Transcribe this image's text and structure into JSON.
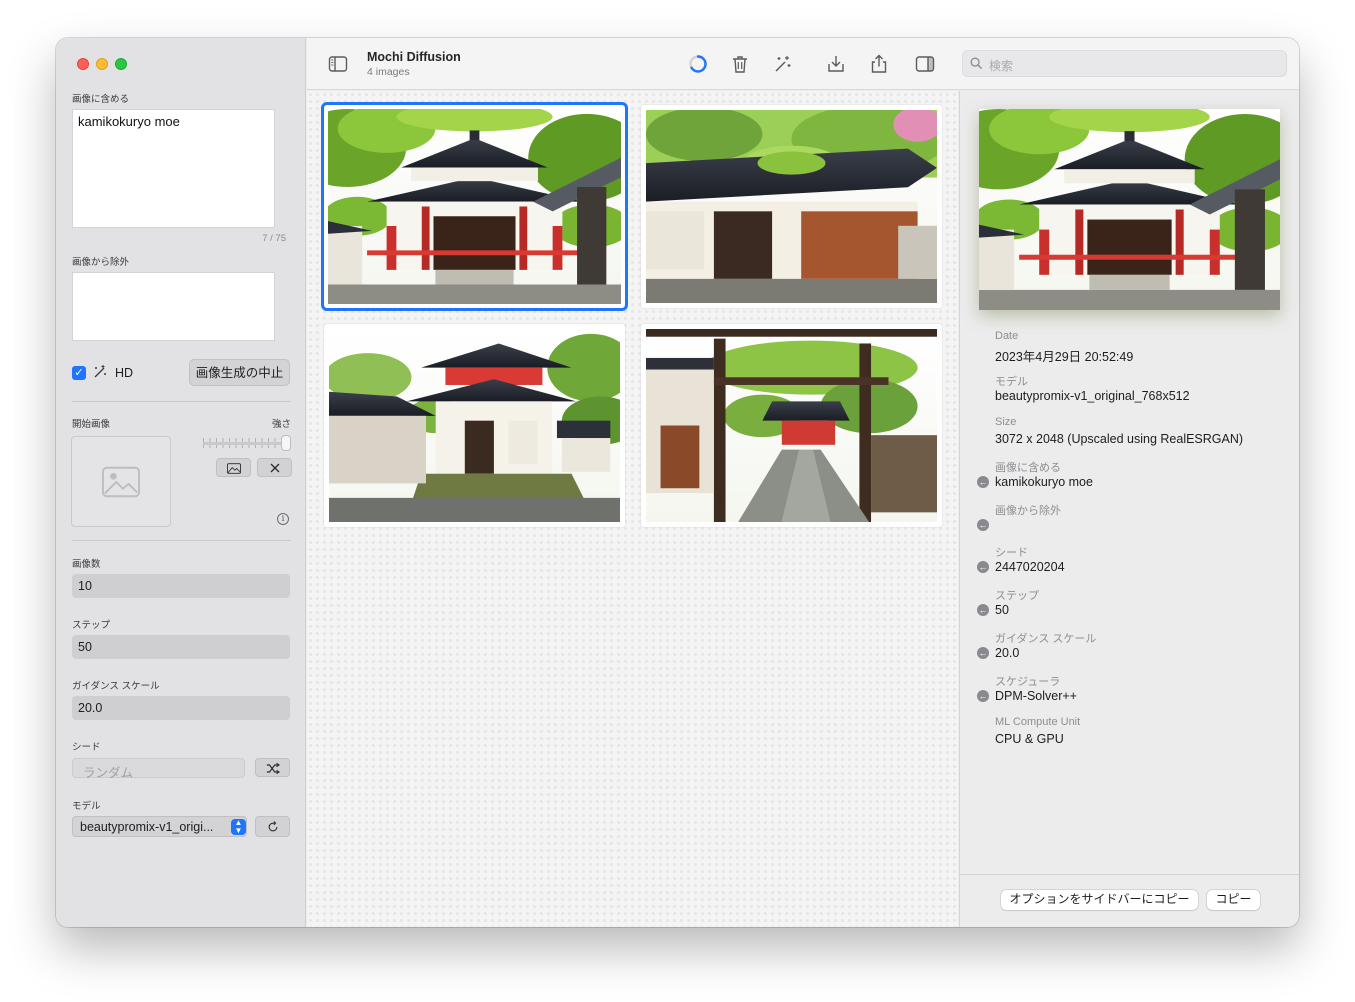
{
  "toolbar": {
    "title": "Mochi Diffusion",
    "subtitle": "4 images",
    "search_placeholder": "検索",
    "icons": [
      "sidebar-toggle-icon",
      "progress-spinner-icon",
      "trash-icon",
      "magic-wand-icon",
      "download-icon",
      "share-icon",
      "inspector-toggle-icon",
      "search-icon"
    ]
  },
  "sidebar": {
    "prompt_label": "画像に含める",
    "prompt_value": "kamikokuryo moe",
    "prompt_counter": "7 / 75",
    "negative_label": "画像から除外",
    "negative_value": "",
    "hd_checked": true,
    "hd_label": "HD",
    "stop_button": "画像生成の中止",
    "start_image_label": "開始画像",
    "strength_label": "強さ",
    "image_count_label": "画像数",
    "image_count_value": "10",
    "steps_label": "ステップ",
    "steps_value": "50",
    "guidance_label": "ガイダンス スケール",
    "guidance_value": "20.0",
    "seed_label": "シード",
    "seed_placeholder": "ランダム",
    "model_label": "モデル",
    "model_value": "beautypromix-v1_origi..."
  },
  "gallery": {
    "images": [
      {
        "alt": "temple-front",
        "selected": true
      },
      {
        "alt": "temple-side",
        "selected": false
      },
      {
        "alt": "pagoda-corner",
        "selected": false
      },
      {
        "alt": "torii-path",
        "selected": false
      }
    ]
  },
  "inspector": {
    "date_label": "Date",
    "date_value": "2023年4月29日 20:52:49",
    "model_label": "モデル",
    "model_value": "beautypromix-v1_original_768x512",
    "size_label": "Size",
    "size_value": "3072 x 2048 (Upscaled using RealESRGAN)",
    "prompt_label": "画像に含める",
    "prompt_value": "kamikokuryo moe",
    "negative_label": "画像から除外",
    "negative_value": "",
    "seed_label": "シード",
    "seed_value": "2447020204",
    "steps_label": "ステップ",
    "steps_value": "50",
    "guidance_label": "ガイダンス スケール",
    "guidance_value": "20.0",
    "scheduler_label": "スケジューラ",
    "scheduler_value": "DPM-Solver++",
    "compute_label": "ML Compute Unit",
    "compute_value": "CPU & GPU",
    "copy_to_sidebar_button": "オプションをサイドバーにコピー",
    "copy_button": "コピー"
  },
  "colors": {
    "accent": "#1f75fe",
    "close": "#fe5f57",
    "minimize": "#febc2e",
    "zoom": "#28c840"
  }
}
